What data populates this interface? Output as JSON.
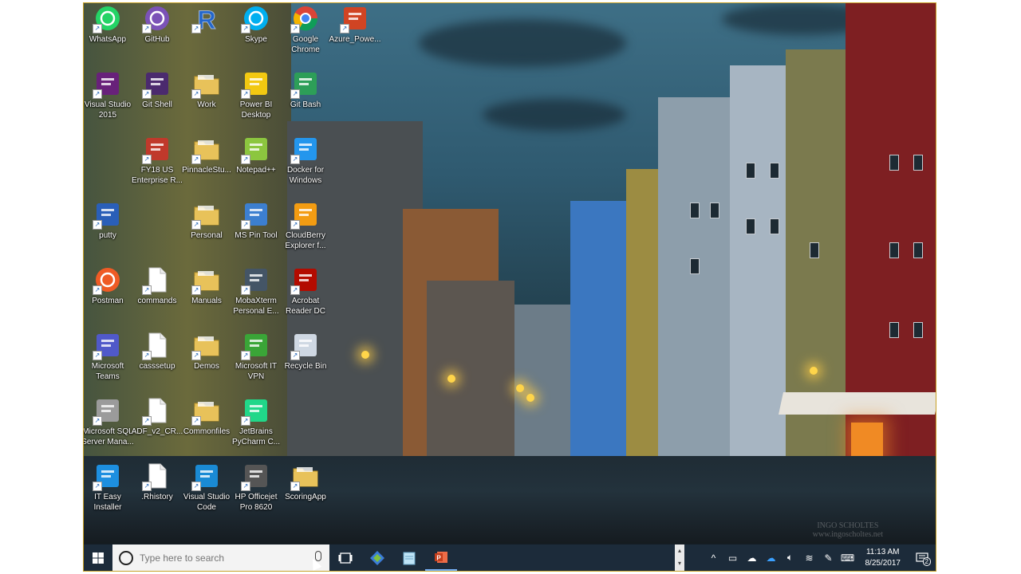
{
  "desktop": {
    "icons": [
      {
        "label": "WhatsApp",
        "icon": "whatsapp-icon",
        "color": "#25d366"
      },
      {
        "label": "GitHub",
        "icon": "github-icon",
        "color": "#7b52b7"
      },
      {
        "label": "",
        "icon": "r-language-icon",
        "color": "#2266cc"
      },
      {
        "label": "Skype",
        "icon": "skype-icon",
        "color": "#00aff0"
      },
      {
        "label": "Google Chrome",
        "icon": "chrome-icon",
        "color": "#db4437"
      },
      {
        "label": "Azure_Powe...",
        "icon": "azure-powerpoint-icon",
        "color": "#d04423"
      },
      {
        "label": "Visual Studio 2015",
        "icon": "visual-studio-icon",
        "color": "#68217a"
      },
      {
        "label": "Git Shell",
        "icon": "git-shell-icon",
        "color": "#4b2a6e"
      },
      {
        "label": "Work",
        "icon": "folder-icon",
        "color": "#e8c25a"
      },
      {
        "label": "Power BI Desktop",
        "icon": "power-bi-icon",
        "color": "#f2c811"
      },
      {
        "label": "Git Bash",
        "icon": "git-bash-icon",
        "color": "#2d9e58"
      },
      {
        "label": "FY18 US Enterprise R...",
        "icon": "powerpoint-file-icon",
        "color": "#c0392b"
      },
      {
        "label": "PinnacleStu...",
        "icon": "folder-icon",
        "color": "#e8c25a"
      },
      {
        "label": "Notepad++",
        "icon": "notepad-plus-icon",
        "color": "#8cc63f"
      },
      {
        "label": "Docker for Windows",
        "icon": "docker-icon",
        "color": "#2496ed"
      },
      {
        "label": "putty",
        "icon": "putty-icon",
        "color": "#2a5fb8"
      },
      {
        "label": "Personal",
        "icon": "folder-icon",
        "color": "#e8c25a"
      },
      {
        "label": "MS Pin Tool",
        "icon": "ms-pin-tool-icon",
        "color": "#3c7fd0"
      },
      {
        "label": "CloudBerry Explorer f...",
        "icon": "cloudberry-icon",
        "color": "#f39c12"
      },
      {
        "label": "Postman",
        "icon": "postman-icon",
        "color": "#ef5b25"
      },
      {
        "label": "commands",
        "icon": "text-file-icon",
        "color": "#ffffff"
      },
      {
        "label": "Manuals",
        "icon": "folder-icon",
        "color": "#e8c25a"
      },
      {
        "label": "MobaXterm Personal E...",
        "icon": "mobaxterm-icon",
        "color": "#445566"
      },
      {
        "label": "Acrobat Reader DC",
        "icon": "acrobat-icon",
        "color": "#b30b00"
      },
      {
        "label": "Microsoft Teams",
        "icon": "teams-icon",
        "color": "#5059c9"
      },
      {
        "label": "casssetup",
        "icon": "text-file-icon",
        "color": "#ffffff"
      },
      {
        "label": "Demos",
        "icon": "folder-icon",
        "color": "#e8c25a"
      },
      {
        "label": "Microsoft IT VPN",
        "icon": "vpn-icon",
        "color": "#3aa537"
      },
      {
        "label": "Recycle Bin",
        "icon": "recycle-bin-icon",
        "color": "#cfd8e3"
      },
      {
        "label": "Microsoft SQL Server Mana...",
        "icon": "sql-server-icon",
        "color": "#9b9b9b"
      },
      {
        "label": "ADF_v2_CR...",
        "icon": "text-file-icon",
        "color": "#ffffff"
      },
      {
        "label": "Commonfiles",
        "icon": "folder-icon",
        "color": "#e8c25a"
      },
      {
        "label": "JetBrains PyCharm C...",
        "icon": "pycharm-icon",
        "color": "#21d789"
      },
      {
        "label": "IT Easy Installer",
        "icon": "it-easy-installer-icon",
        "color": "#1d8fe0"
      },
      {
        "label": ".Rhistory",
        "icon": "text-file-icon",
        "color": "#ffffff"
      },
      {
        "label": "Visual Studio Code",
        "icon": "vscode-icon",
        "color": "#1a8ad4"
      },
      {
        "label": "HP Officejet Pro 8620",
        "icon": "printer-icon",
        "color": "#555555"
      },
      {
        "label": "ScoringApp",
        "icon": "folder-icon",
        "color": "#e8c25a"
      }
    ],
    "watermark_line1": "INGO SCHOLTES",
    "watermark_line2": "www.ingoscholtes.net"
  },
  "taskbar": {
    "search_placeholder": "Type here to search",
    "time": "11:13 AM",
    "date": "8/25/2017",
    "notification_count": "2",
    "pinned": [
      "task-view-icon",
      "git-extensions-icon",
      "notepad-icon",
      "powerpoint-icon"
    ]
  }
}
